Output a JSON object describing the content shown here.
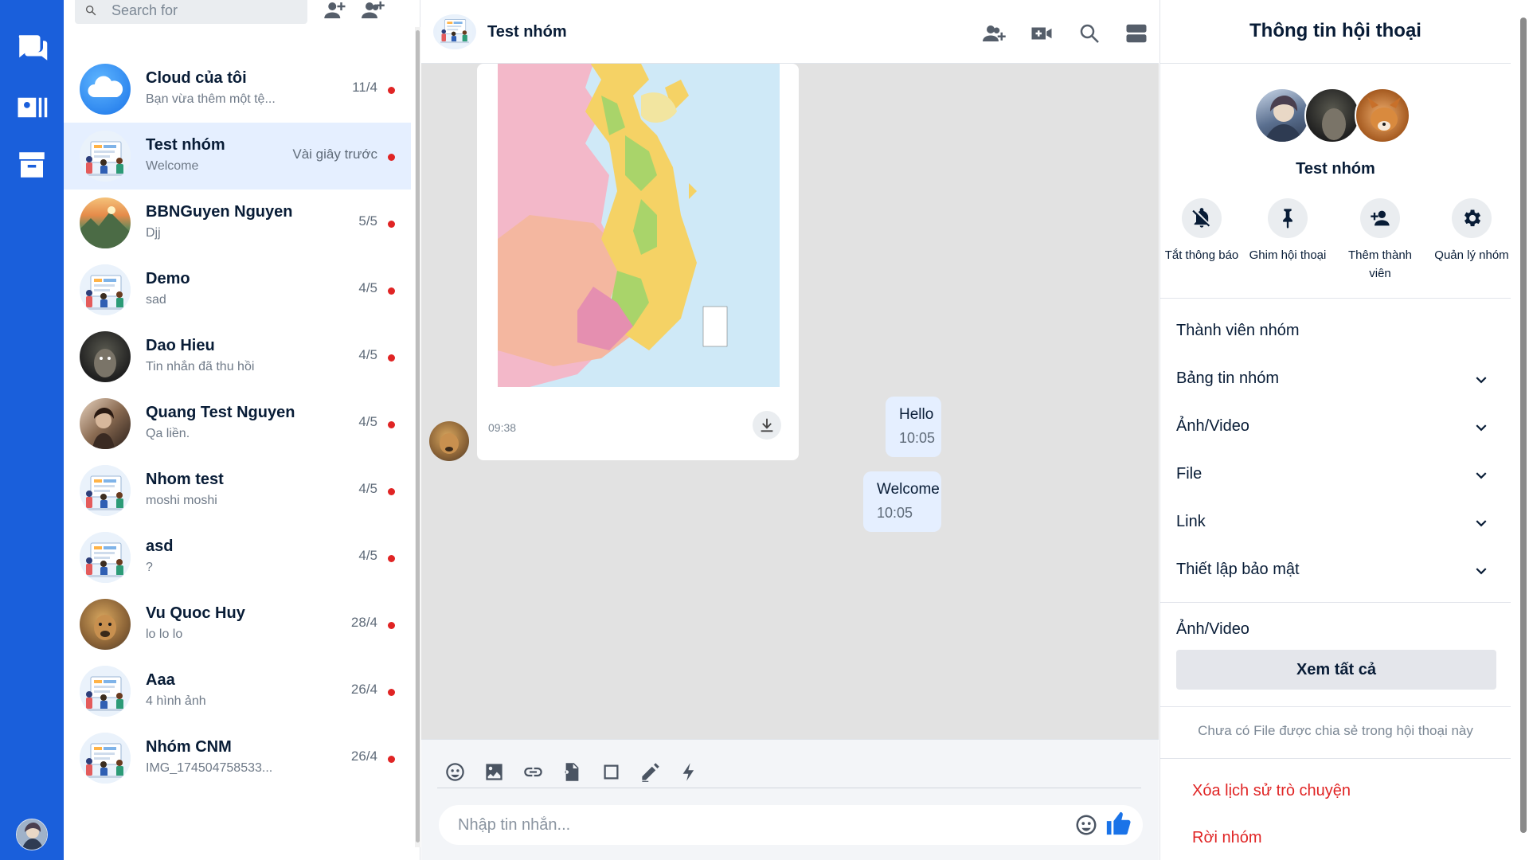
{
  "sidebar": {
    "nav": [
      {
        "icon": "chat-icon"
      },
      {
        "icon": "contacts-icon"
      },
      {
        "icon": "archive-icon"
      }
    ],
    "profile_icon": "user-avatar"
  },
  "conversation_list": {
    "search": {
      "placeholder": "Search for"
    },
    "header_icons": [
      "add-friend-icon",
      "create-group-icon"
    ],
    "items": [
      {
        "name": "Cloud của tôi",
        "last": "Bạn vừa thêm một tệ...",
        "time": "11/4",
        "avatar": "cloud",
        "unread": true
      },
      {
        "name": "Test nhóm",
        "last": "Welcome",
        "time": "Vài giây trước",
        "avatar": "group",
        "unread": true,
        "active": true
      },
      {
        "name": "BBNGuyen Nguyen",
        "last": "Djj",
        "time": "5/5",
        "avatar": "landscape",
        "unread": true
      },
      {
        "name": "Demo",
        "last": "sad",
        "time": "4/5",
        "avatar": "group",
        "unread": true
      },
      {
        "name": "Dao Hieu",
        "last": "Tin nhắn đã thu hồi",
        "time": "4/5",
        "avatar": "dark",
        "unread": true
      },
      {
        "name": "Quang Test Nguyen",
        "last": "Qa liền.",
        "time": "4/5",
        "avatar": "photo",
        "unread": true
      },
      {
        "name": "Nhom test",
        "last": "moshi moshi",
        "time": "4/5",
        "avatar": "group",
        "unread": true
      },
      {
        "name": "asd",
        "last": "?",
        "time": "4/5",
        "avatar": "group",
        "unread": true
      },
      {
        "name": "Vu Quoc Huy",
        "last": "lo lo lo",
        "time": "28/4",
        "avatar": "dog",
        "unread": true
      },
      {
        "name": "Aaa",
        "last": "4 hình ảnh",
        "time": "26/4",
        "avatar": "group",
        "unread": true
      },
      {
        "name": "Nhóm CNM",
        "last": "IMG_174504758533...",
        "time": "26/4",
        "avatar": "group",
        "unread": true
      }
    ]
  },
  "chat": {
    "title": "Test nhóm",
    "header_icons": [
      "add-member-icon",
      "video-call-icon",
      "search-icon",
      "toggle-info-icon"
    ],
    "image_message": {
      "time": "09:38"
    },
    "messages": [
      {
        "text": "Hello",
        "time": "10:05"
      },
      {
        "text": "Welcome",
        "time": "10:05"
      }
    ],
    "toolbar": [
      "emoji-icon",
      "image-icon",
      "link-icon",
      "file-icon",
      "square-icon",
      "draw-icon",
      "bolt-icon"
    ],
    "input": {
      "placeholder": "Nhập tin nhắn..."
    }
  },
  "info_panel": {
    "title": "Thông tin hội thoại",
    "group_name": "Test nhóm",
    "actions": [
      {
        "label": "Tắt thông báo",
        "icon": "bell-off-icon"
      },
      {
        "label": "Ghim hội thoại",
        "icon": "pin-icon"
      },
      {
        "label": "Thêm thành viên",
        "icon": "add-member-icon"
      },
      {
        "label": "Quản lý nhóm",
        "icon": "gear-icon"
      }
    ],
    "sections": [
      "Thành viên nhóm",
      "Bảng tin nhóm",
      "Ảnh/Video",
      "File",
      "Link",
      "Thiết lập bảo mật"
    ],
    "media_label": "Ảnh/Video",
    "see_all": "Xem tất cả",
    "no_file": "Chưa có File được chia sẻ trong hội thoại này",
    "clear_history": "Xóa lịch sử trò chuyện",
    "leave_group": "Rời nhóm",
    "danger_color": "#e02424"
  },
  "colors": {
    "rail": "#1a5fdb",
    "active_row": "#e5efff",
    "bubble": "#e5efff",
    "unread_dot": "#e02424",
    "like": "#1a73e8"
  }
}
